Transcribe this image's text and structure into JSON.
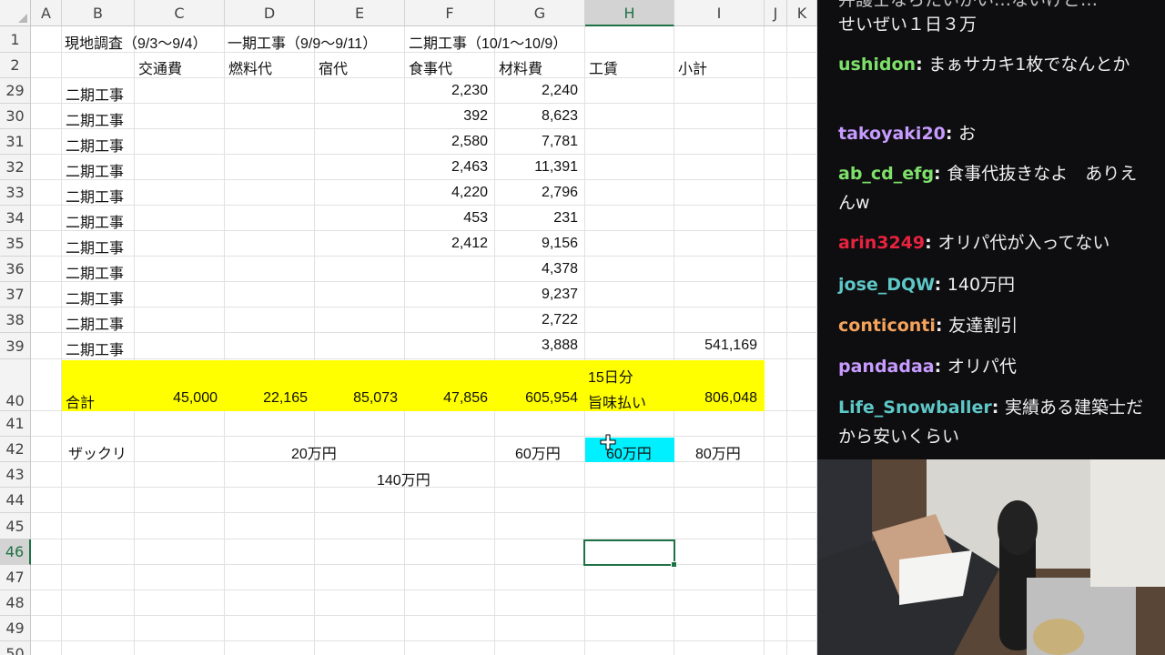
{
  "sheet": {
    "columns": [
      "A",
      "B",
      "C",
      "D",
      "E",
      "F",
      "G",
      "H",
      "I",
      "J",
      "K"
    ],
    "rows": [
      "1",
      "2",
      "29",
      "30",
      "31",
      "32",
      "33",
      "34",
      "35",
      "36",
      "37",
      "38",
      "39",
      "40",
      "41",
      "42",
      "43",
      "44",
      "45",
      "46",
      "47",
      "48",
      "49",
      "50"
    ],
    "selected_column": "H",
    "selected_row": "46",
    "row1": {
      "b": "現地調査（9/3〜9/4）",
      "d": "一期工事（9/9〜9/11）",
      "f": "二期工事（10/1〜10/9）"
    },
    "row2": {
      "c": "交通費",
      "d": "燃料代",
      "e": "宿代",
      "f": "食事代",
      "g": "材料費",
      "h": "工賃",
      "i": "小計"
    },
    "data_rows": [
      {
        "b": "二期工事",
        "f": "2,230",
        "g": "2,240",
        "i": ""
      },
      {
        "b": "二期工事",
        "f": "392",
        "g": "8,623",
        "i": ""
      },
      {
        "b": "二期工事",
        "f": "2,580",
        "g": "7,781",
        "i": ""
      },
      {
        "b": "二期工事",
        "f": "2,463",
        "g": "11,391",
        "i": ""
      },
      {
        "b": "二期工事",
        "f": "4,220",
        "g": "2,796",
        "i": ""
      },
      {
        "b": "二期工事",
        "f": "453",
        "g": "231",
        "i": ""
      },
      {
        "b": "二期工事",
        "f": "2,412",
        "g": "9,156",
        "i": ""
      },
      {
        "b": "二期工事",
        "f": "",
        "g": "4,378",
        "i": ""
      },
      {
        "b": "二期工事",
        "f": "",
        "g": "9,237",
        "i": ""
      },
      {
        "b": "二期工事",
        "f": "",
        "g": "2,722",
        "i": ""
      },
      {
        "b": "二期工事",
        "f": "",
        "g": "3,888",
        "i": "541,169"
      }
    ],
    "total": {
      "label": "合計",
      "c": "45,000",
      "d": "22,165",
      "e": "85,073",
      "f": "47,856",
      "g": "605,954",
      "h_line1": "15日分",
      "h_line2": "旨味払い",
      "i": "806,048"
    },
    "rough": {
      "label": "ザックリ",
      "cf": "20万円",
      "g": "60万円",
      "h": "60万円",
      "i": "80万円"
    },
    "sum43": "140万円",
    "colors": {
      "highlight_yellow": "#ffff00",
      "highlight_cyan": "#00f0ff",
      "excel_green": "#1e7145"
    }
  },
  "chat": {
    "messages": [
      {
        "user": "",
        "color": "#efeff1",
        "text": "せいぜい１日３万",
        "partial_top": "弁護士ならたいがい…ないけど…"
      },
      {
        "user": "ushidon",
        "color": "#7ee06a",
        "text": "まぁサカキ1枚でなんとか"
      },
      {
        "user": "takoyaki20",
        "color": "#c79bff",
        "text": "お"
      },
      {
        "user": "ab_cd_efg",
        "color": "#7ee06a",
        "text": "食事代抜きなよ　ありえんw"
      },
      {
        "user": "arin3249",
        "color": "#e8223f",
        "text": "オリパ代が入ってない"
      },
      {
        "user": "jose_DQW",
        "color": "#5ec7c7",
        "text": "140万円"
      },
      {
        "user": "conticonti",
        "color": "#f5a35b",
        "text": "友達割引"
      },
      {
        "user": "pandadaa",
        "color": "#c79bff",
        "text": "オリパ代"
      },
      {
        "user": "Life_Snowballer",
        "color": "#5ec7c7",
        "text": "実績ある建築士だから安いくらい"
      }
    ]
  },
  "webcam": {
    "description_icon": "webcam-feed"
  }
}
